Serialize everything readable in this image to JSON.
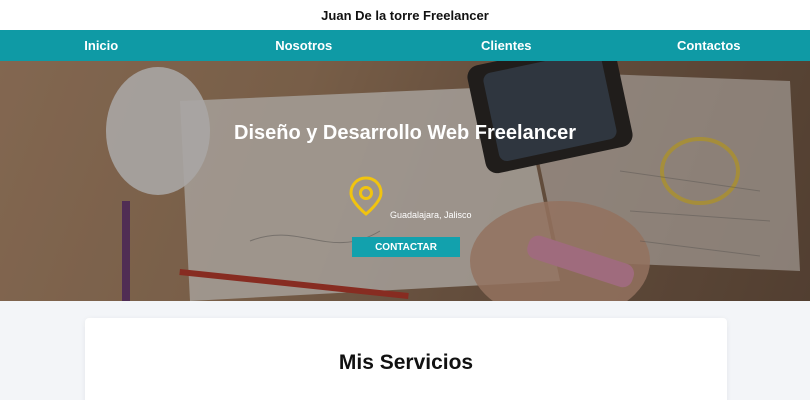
{
  "site": {
    "title": "Juan De la torre Freelancer"
  },
  "nav": {
    "items": [
      "Inicio",
      "Nosotros",
      "Clientes",
      "Contactos"
    ]
  },
  "hero": {
    "headline": "Diseño y Desarrollo Web Freelancer",
    "location": "Guadalajara, Jalisco",
    "cta_label": "CONTACTAR",
    "pin_icon": "location-pin-icon",
    "pin_color": "#f1c40f",
    "accent": "#0f9aa5"
  },
  "services": {
    "title": "Mis Servicios"
  }
}
